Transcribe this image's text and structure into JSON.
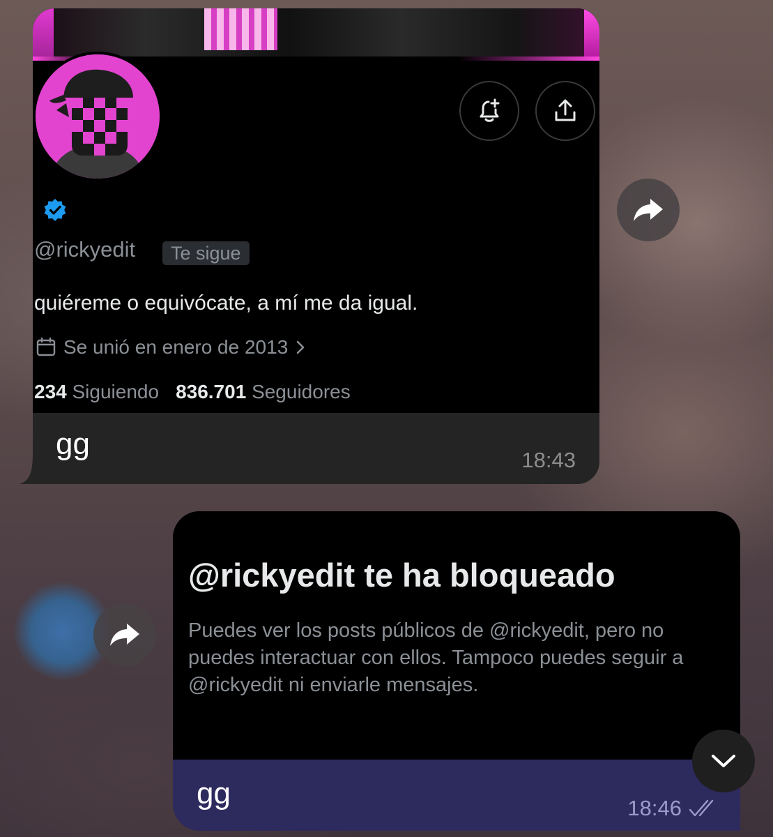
{
  "incoming_message": {
    "profile_card": {
      "handle": "@rickyedit",
      "follows_you_badge": "Te sigue",
      "bio": "quiéreme o equivócate, a mí me da igual.",
      "joined": "Se unió en enero de 2013",
      "following_count": "234",
      "following_label": "Siguiendo",
      "followers_count": "836.701",
      "followers_label": "Seguidores",
      "icons": [
        "bell-plus-icon",
        "share-icon",
        "verified-icon",
        "calendar-icon",
        "chevron-right-icon"
      ]
    },
    "text": "gg",
    "time": "18:43"
  },
  "outgoing_message": {
    "blocked_card": {
      "title": "@rickyedit te ha bloqueado",
      "body": "Puedes ver los posts públicos de @rickyedit, pero no puedes interactuar con ellos. Tampoco puedes seguir a @rickyedit ni enviarle mensajes."
    },
    "text": "gg",
    "time": "18:46",
    "status_icon": "double-check-icon"
  },
  "controls": {
    "forward_icon": "forward-icon",
    "scroll_down_icon": "chevron-down-icon"
  },
  "colors": {
    "incoming_bubble": "#242424",
    "outgoing_bubble": "#2d2a5e",
    "verified_blue": "#1d9bf0",
    "avatar_pink": "#e244cf"
  }
}
